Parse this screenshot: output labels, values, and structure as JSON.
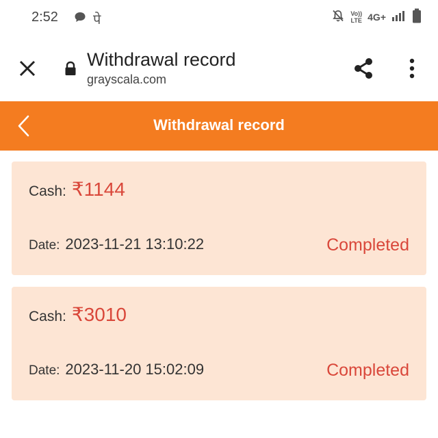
{
  "status_bar": {
    "time": "2:52",
    "app_glyph": "पे",
    "network_type": "4G+",
    "volte_label_top": "Vo))",
    "volte_label_bottom": "LTE"
  },
  "browser": {
    "title": "Withdrawal record",
    "url": "grayscala.com"
  },
  "header": {
    "title": "Withdrawal record"
  },
  "records": [
    {
      "cash_label": "Cash:",
      "amount": "₹1144",
      "date_label": "Date:",
      "date": "2023-11-21 13:10:22",
      "status": "Completed"
    },
    {
      "cash_label": "Cash:",
      "amount": "₹3010",
      "date_label": "Date:",
      "date": "2023-11-20 15:02:09",
      "status": "Completed"
    }
  ],
  "colors": {
    "accent": "#f47c20",
    "card_bg": "#fde5d4",
    "amount_red": "#d9473a"
  },
  "icons": [
    "close-icon",
    "lock-icon",
    "share-icon",
    "more-vert-icon",
    "back-chevron-icon",
    "chat-bubble-icon",
    "notifications-off-icon",
    "signal-icon",
    "battery-icon"
  ]
}
